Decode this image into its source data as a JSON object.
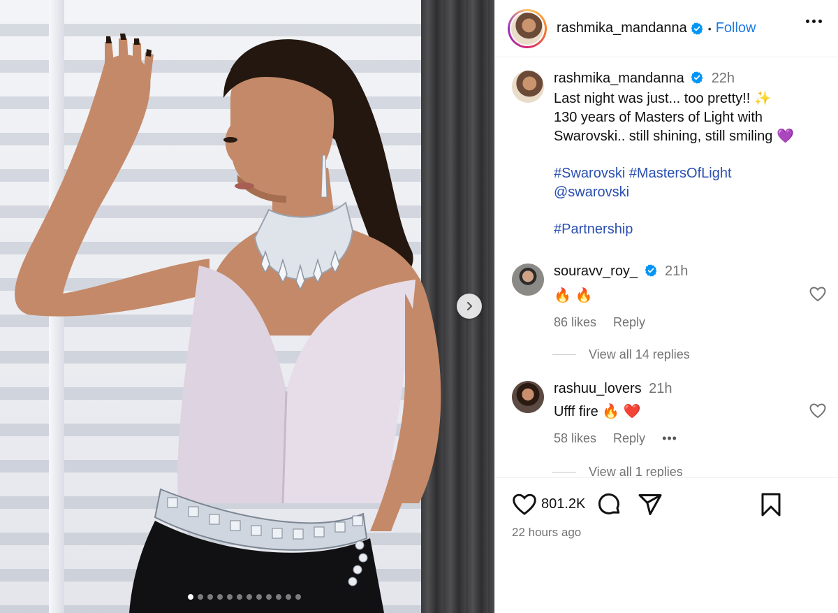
{
  "post": {
    "author": "rashmika_mandanna",
    "follow_label": "Follow",
    "separator": "•",
    "caption": {
      "time": "22h",
      "line1": "Last night was just... too pretty!! ✨",
      "line2": "130 years of Masters of Light with",
      "line3": "Swarovski.. still shining, still smiling 💜",
      "hashtags1": "#Swarovski #MastersOfLight",
      "mention": "@swarovski",
      "hashtags2": "#Partnership"
    },
    "like_count": "801.2K",
    "posted_ago": "22 hours ago"
  },
  "comments": [
    {
      "username": "souravv_roy_",
      "verified": true,
      "time": "21h",
      "text": "🔥 🔥",
      "likes": "86 likes",
      "reply_label": "Reply",
      "view_replies": "View all 14 replies"
    },
    {
      "username": "rashuu_lovers",
      "verified": false,
      "time": "21h",
      "text": "Ufff fire 🔥 ❤️",
      "likes": "58 likes",
      "reply_label": "Reply",
      "more": "•••",
      "view_replies": "View all 1 replies"
    }
  ],
  "carousel": {
    "slide_count": 12,
    "active_index": 0
  },
  "icons": {
    "verified": "verified-badge-icon",
    "more": "more-options-icon",
    "heart": "heart-icon",
    "comment": "comment-icon",
    "share": "share-icon",
    "save": "bookmark-icon",
    "next": "chevron-right-icon"
  },
  "colors": {
    "verified_blue": "#0095f6",
    "link_blue": "#2a4fb0",
    "follow_blue": "#1f7ae0",
    "muted": "#737373"
  }
}
